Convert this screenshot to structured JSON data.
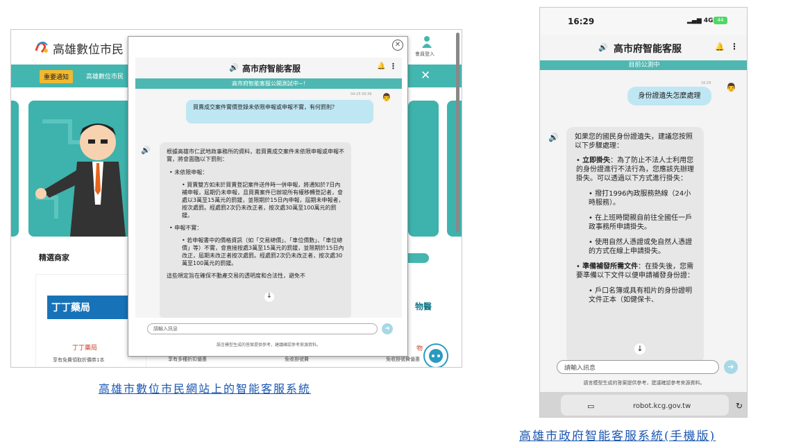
{
  "desktop": {
    "site_name": "高雄數位市民",
    "member_label": "會員登入",
    "notice_badge": "重要通知",
    "notice_text": "高雄數位市民",
    "notice_close": "✕",
    "shops_title": "精選商家",
    "shop": {
      "logo_text": "丁丁藥局",
      "name": "丁丁藥局",
      "desc": "享有免費領取折價券1本"
    },
    "bottom_texts": [
      "享有多種折扣優惠",
      "免收掛號費",
      "免收掛號費優惠"
    ],
    "right_side_text": "物醫",
    "right_side_shop": "物",
    "modal": {
      "close_icon": "✕",
      "title": "高市府智能客服",
      "subtitle": "高市府智能客服公開測試中~!",
      "user_time": "04-25 09:36",
      "user_message": "買賣成交案件實價登錄未依限申報或申報不實，有何罰則？",
      "bot_intro": "根據高雄市仁武地政事務所的資料，若買賣成交案件未依限申報或申報不實，將會面臨以下罰則：",
      "bullet1_title": "未依限申報：",
      "bullet1_detail": "買賣雙方如未於買賣登記案件送件時一併申報，將通知於7日內補申報，屆期仍未申報，且買賣案件已辦竣所有權移轉登記者，會處以3萬至15萬元的罰鍰，並限期於15日內申報，屆期未申報者，按次處罰。經處罰2次仍未改正者，按次處30萬至100萬元的罰鍰。",
      "bullet2_title": "申報不實：",
      "bullet2_detail": "若申報書中的價格資訊（如「交易總價」、「車位價數」、「車位總價」等）不實，會直接按處3萬至15萬元的罰鍰，並限期於15日內改正，屆期未改正者按次處罰。經處罰2次仍未改正者，按次處30萬至100萬元的罰鍰。",
      "bot_outro": "這些規定旨在確保不動產交易的透明度和合法性，避免不",
      "scroll_down": "↓",
      "input_placeholder": "請輸入訊息",
      "send": "➜",
      "disclaimer": "語言模型生成的答案提供參考，建議確認參考來源資料。"
    }
  },
  "mobile": {
    "status_time": "16:29",
    "status_signal": "4G",
    "battery": "44",
    "title": "高市府智能客服",
    "subtitle": "目前公測中",
    "user_time": "16:29",
    "user_message": "身份證遺失怎麼處理",
    "bot_intro": "如果您的國民身份證遺失，建議您按照以下步驟處理：",
    "bullet1_title": "立即掛失",
    "bullet1_text": "：為了防止不法人士利用您的身份證進行不法行為，您應該先辦理掛失。可以透過以下方式進行掛失：",
    "sub1": "撥打1996內政服務熱線（24小時服務）。",
    "sub2": "在上班時間親自前往全國任一戶政事務所申請掛失。",
    "sub3": "使用自然人憑證或免自然人憑證的方式在線上申請掛失。",
    "bullet2_title": "準備補發所需文件",
    "bullet2_text": "：在掛失後，您需要準備以下文件以便申請補發身份證：",
    "sub4": "戶口名簿或具有相片的身份證明文件正本（如健保卡、",
    "scroll_down": "↓",
    "input_placeholder": "請輸入訊息",
    "send": "➜",
    "disclaimer": "語言模型生成的答案提供參考，建議確認參考來源資料。",
    "url": "robot.kcg.gov.tw"
  },
  "captions": {
    "desktop": "高雄市數位市民網站上的智能客服系統",
    "mobile": "高雄市政府智能客服系統(手機版)"
  },
  "colors": {
    "teal": "#44b6b0",
    "user_bubble": "#bfe6f3",
    "bot_bubble": "#e7e7e7",
    "caption": "#1a56b0"
  }
}
